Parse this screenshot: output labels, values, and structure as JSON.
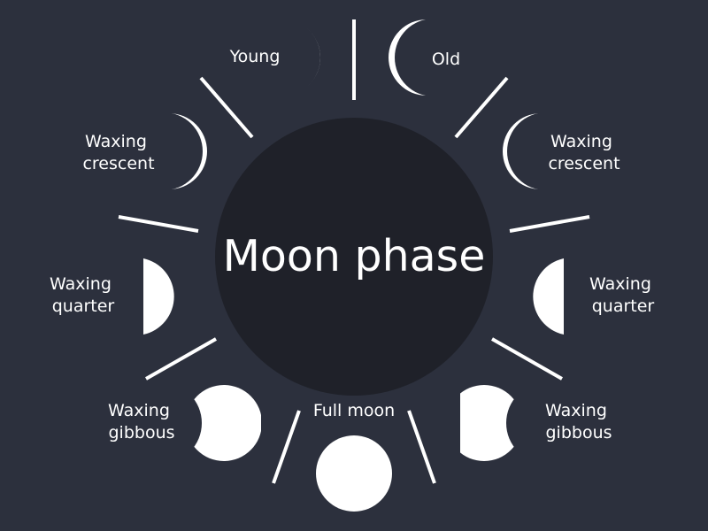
{
  "title": "Moon phase",
  "colors": {
    "background": "#2c303d",
    "center_disc": "#1f2129",
    "moon": "#ffffff",
    "lines": "#ffffff"
  },
  "phases": [
    {
      "key": "young",
      "lines": [
        "Young"
      ]
    },
    {
      "key": "old",
      "lines": [
        "Old"
      ]
    },
    {
      "key": "waxing-crescent-left",
      "lines": [
        "Waxing",
        "crescent"
      ]
    },
    {
      "key": "waxing-crescent-right",
      "lines": [
        "Waxing",
        "crescent"
      ]
    },
    {
      "key": "waxing-quarter-left",
      "lines": [
        "Waxing",
        "quarter"
      ]
    },
    {
      "key": "waxing-quarter-right",
      "lines": [
        "Waxing",
        "quarter"
      ]
    },
    {
      "key": "waxing-gibbous-left",
      "lines": [
        "Waxing",
        "gibbous"
      ]
    },
    {
      "key": "waxing-gibbous-right",
      "lines": [
        "Waxing",
        "gibbous"
      ]
    },
    {
      "key": "full-moon",
      "lines": [
        "Full moon"
      ]
    }
  ]
}
